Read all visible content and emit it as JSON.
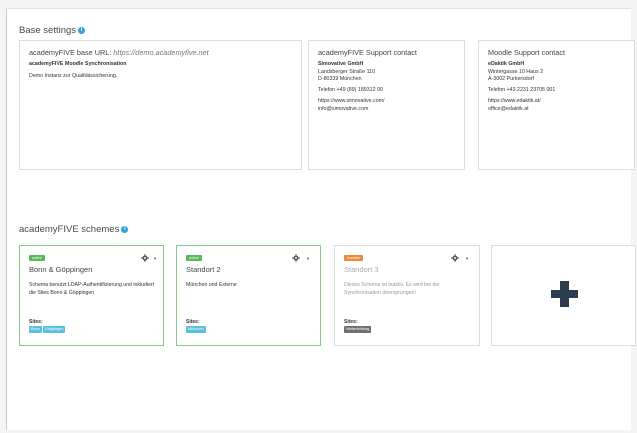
{
  "base_settings": {
    "title": "Base settings",
    "info_icon": "info-icon",
    "academyfive": {
      "label": "academyFIVE base URL:",
      "url": "https://demo.academyfive.net",
      "sync_name": "academyFIVE Moodle Synchronisation",
      "description": "Demo Instanz zur Qualitätssicherung."
    },
    "academyfive_support": {
      "title": "academyFIVE Support contact",
      "company": "Simovative GmbH",
      "street": "Landsberger Straße 110",
      "city": "D-80339 München",
      "phone": "Telefon +49 (89) 189312 00",
      "web": "https://www.simovative.com/",
      "email": "info@simovative.com"
    },
    "moodle_support": {
      "title": "Moodle Support contact",
      "company": "eDaktik GmbH",
      "street": "Wintergasse 10 Haus 2",
      "city": "A-3002 Purkersdorf",
      "phone": "Telefon +43 2231 23705 001",
      "web": "https://www.edaktik.at/",
      "email": "office@edaktik.at"
    }
  },
  "schemes": {
    "title": "academyFIVE schemes",
    "items": [
      {
        "status": "active",
        "name": "Bonn & Göppingen",
        "description": "Schema benutzt LDAP-Authentifizierung und inkludiert die Sites Bonn & Göppingen",
        "sites_label": "Sites:",
        "sites": [
          "Bonn",
          "Göppingen"
        ]
      },
      {
        "status": "active",
        "name": "Standort 2",
        "description": "München und Externe",
        "sites_label": "Sites:",
        "sites": [
          "München"
        ]
      },
      {
        "status": "inactive",
        "name": "Standort 3",
        "description": "Dieses Schema ist inaktiv. Es wird bei der Synchronisation übersprungen!",
        "sites_label": "Sites:",
        "sites": [
          "Weiterbildung"
        ]
      }
    ],
    "add_icon": "plus-icon",
    "gear_icon": "gear-icon",
    "caret_icon": "chevron-down-icon"
  },
  "colors": {
    "active": "#5cb85c",
    "inactive": "#f0883a",
    "site_tag": "#5bc0de",
    "site_tag_inactive": "#6f6f6f",
    "info": "#2aa3d6",
    "plus": "#2c3e4d"
  }
}
